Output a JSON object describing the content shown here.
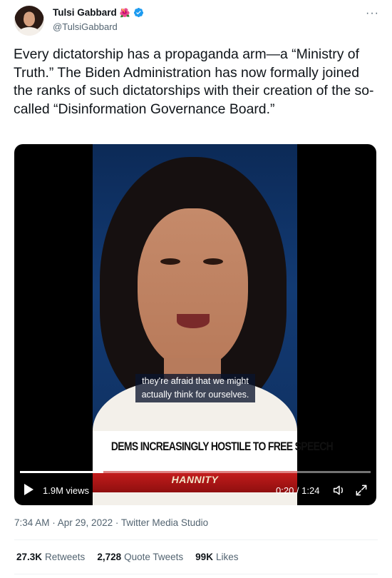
{
  "author": {
    "display_name": "Tulsi Gabbard",
    "emoji": "🌺",
    "handle": "@TulsiGabbard"
  },
  "more_label": "···",
  "tweet": {
    "text": "Every dictatorship has a propaganda arm—a “Ministry of Truth.” The Biden Administration has now formally joined the ranks of such dictatorships with their creation of the so-called “Disinformation Governance Board.”"
  },
  "video": {
    "caption": "they're afraid that we might actually think for ourselves.",
    "lower_third": "DEMS INCREASINGLY HOSTILE TO FREE SPEECH",
    "show_name": "HANNITY",
    "views": "1.9M views",
    "time": "0:20 / 1:24",
    "progress": 0.238
  },
  "meta": {
    "timestamp": "7:34 AM · Apr 29, 2022 · Twitter Media Studio"
  },
  "stats": [
    {
      "num": "27.3K",
      "label": "Retweets"
    },
    {
      "num": "2,728",
      "label": "Quote Tweets"
    },
    {
      "num": "99K",
      "label": "Likes"
    }
  ],
  "colors": {
    "verified": "#1d9bf0",
    "secondary_text": "#536471",
    "primary_text": "#0f1419"
  }
}
